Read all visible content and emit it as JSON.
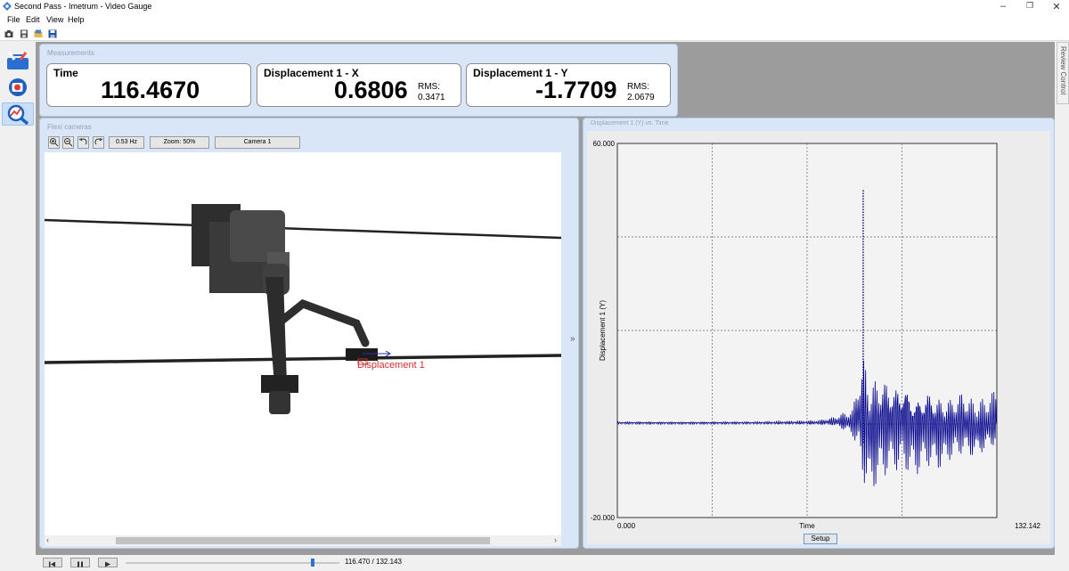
{
  "window": {
    "title": "Second Pass - Imetrum - Video Gauge"
  },
  "menu": [
    "File",
    "Edit",
    "View",
    "Help"
  ],
  "measurements": {
    "panel_title": "Measurements",
    "time": {
      "label": "Time",
      "value": "116.4670"
    },
    "disp_x": {
      "label": "Displacement 1 - X",
      "value": "0.6806",
      "rms_label": "RMS:",
      "rms_value": "0.3471"
    },
    "disp_y": {
      "label": "Displacement 1 - Y",
      "value": "-1.7709",
      "rms_label": "RMS:",
      "rms_value": "2.0679"
    }
  },
  "cameras": {
    "panel_title": "Flexi cameras",
    "rate": "0.53 Hz",
    "zoom": "Zoom: 50%",
    "camera": "Camera 1",
    "target_label": "Displacement 1"
  },
  "plot": {
    "panel_title": "Displacement 1 (Y) vs. Time",
    "setup_label": "Setup",
    "review_tab": "Review Control"
  },
  "chart_data": {
    "type": "scatter",
    "title": "Displacement 1 (Y) vs. Time",
    "xlabel": "Time",
    "ylabel": "Displacement 1 (Y)",
    "xlim": [
      0.0,
      132.142
    ],
    "ylim": [
      -20.0,
      60.0
    ],
    "x_tick_labels": [
      "0.000",
      "132.142"
    ],
    "y_tick_labels": [
      "60.000",
      "-20.000"
    ],
    "grid": true,
    "series": [
      {
        "color": "#00008b",
        "envelope": [
          {
            "x": 0,
            "min": 0.0,
            "max": 0.5
          },
          {
            "x": 50,
            "min": 0.0,
            "max": 0.5
          },
          {
            "x": 70,
            "min": -0.2,
            "max": 0.8
          },
          {
            "x": 75,
            "min": -0.5,
            "max": 1.5
          },
          {
            "x": 80,
            "min": -2.0,
            "max": 3.0
          },
          {
            "x": 82,
            "min": -3.0,
            "max": 3.5
          },
          {
            "x": 84,
            "min": -8.0,
            "max": 12.0
          },
          {
            "x": 85,
            "min": -12.0,
            "max": 14.0
          },
          {
            "x": 86,
            "min": -14.0,
            "max": 17.0
          },
          {
            "x": 88,
            "min": -16.0,
            "max": 12.0
          },
          {
            "x": 92,
            "min": -12.0,
            "max": 13.0
          },
          {
            "x": 96,
            "min": -10.0,
            "max": 11.0
          },
          {
            "x": 100,
            "min": -10.0,
            "max": 12.0
          },
          {
            "x": 104,
            "min": -11.0,
            "max": 9.0
          },
          {
            "x": 108,
            "min": -9.0,
            "max": 10.0
          },
          {
            "x": 112,
            "min": -10.0,
            "max": 8.0
          },
          {
            "x": 116,
            "min": -8.0,
            "max": 7.0
          },
          {
            "x": 120,
            "min": -7.0,
            "max": 8.0
          },
          {
            "x": 124,
            "min": -8.0,
            "max": 6.0
          },
          {
            "x": 128,
            "min": -7.0,
            "max": 6.0
          },
          {
            "x": 132,
            "min": -6.0,
            "max": 8.0
          }
        ],
        "spike": {
          "x": 85.6,
          "min": -4.0,
          "max": 50.0
        }
      }
    ]
  },
  "playback": {
    "position": "116.470 / 132.143",
    "progress": 0.881
  }
}
